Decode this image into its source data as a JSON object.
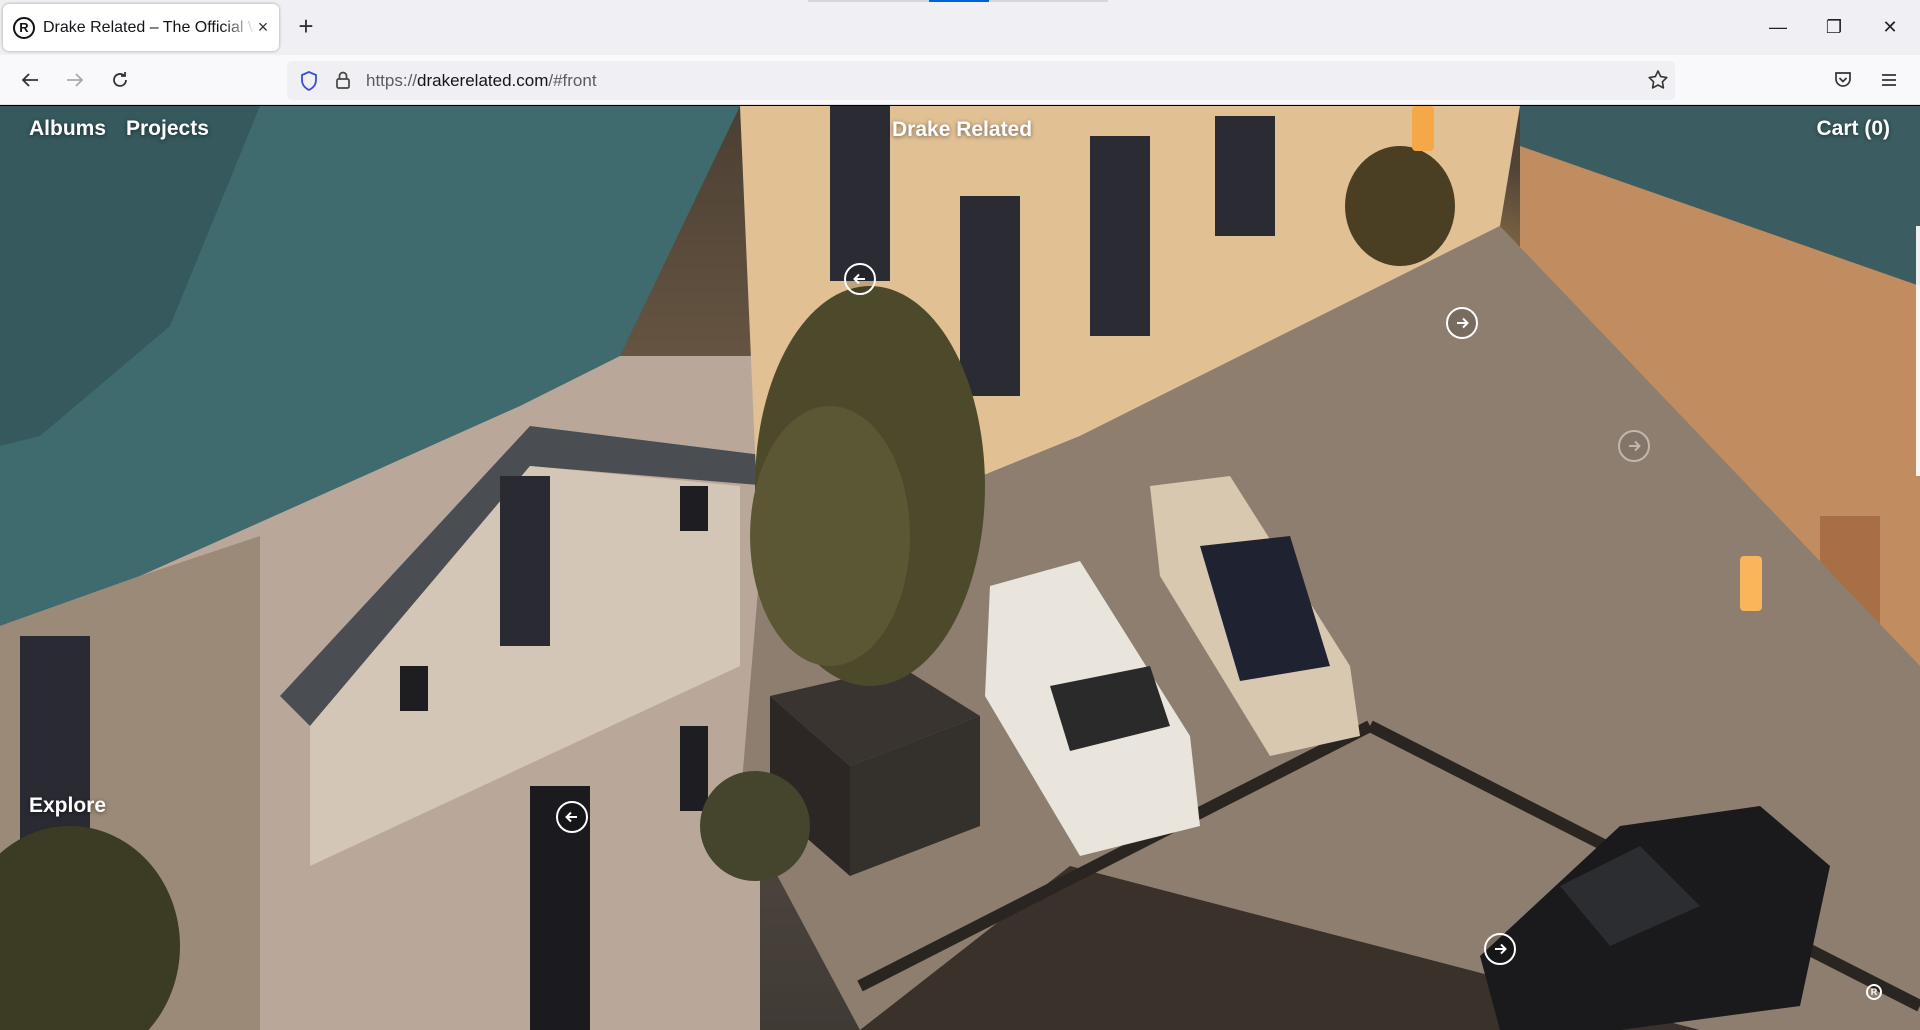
{
  "browser": {
    "tab": {
      "title": "Drake Related – The Official Website",
      "favicon": "R"
    },
    "url": {
      "scheme": "https://",
      "host": "drakerelated.com",
      "path": "/#front"
    },
    "icons": {
      "back": "arrow-left-icon",
      "forward": "arrow-right-icon",
      "reload": "reload-icon",
      "shield": "shield-icon",
      "lock": "lock-icon",
      "bookmark": "star-icon",
      "pocket": "pocket-icon",
      "menu": "hamburger-menu-icon",
      "new_tab": "plus-icon",
      "close_tab": "close-icon",
      "minimize": "minimize-icon",
      "restore": "restore-icon",
      "close_window": "close-icon"
    },
    "glyphs": {
      "new_tab": "+",
      "close_tab": "×",
      "minimize": "—",
      "restore": "❐",
      "close_window": "✕"
    }
  },
  "site": {
    "nav": {
      "albums": "Albums",
      "projects": "Projects",
      "brand": "Drake Related",
      "cart": "Cart (0)"
    },
    "explore": "Explore",
    "registered_mark": "R",
    "hotspots": [
      {
        "direction": "left"
      },
      {
        "direction": "right"
      },
      {
        "direction": "right"
      },
      {
        "direction": "left"
      },
      {
        "direction": "right"
      }
    ]
  },
  "colors": {
    "accent": "#0061e0",
    "text_on_image": "#ffffff"
  }
}
